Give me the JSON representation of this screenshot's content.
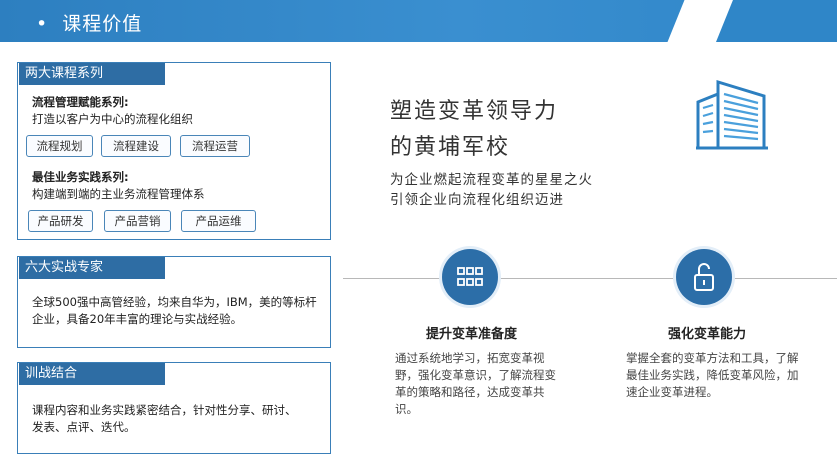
{
  "header": {
    "bullet": "•",
    "title": "课程价值"
  },
  "card1": {
    "tab": "两大课程系列",
    "series1": {
      "title": "流程管理赋能系列:",
      "desc": "打造以客户为中心的流程化组织",
      "tags": [
        "流程规划",
        "流程建设",
        "流程运营"
      ]
    },
    "series2": {
      "title": "最佳业务实践系列:",
      "desc": "构建端到端的主业务流程管理体系",
      "tags": [
        "产品研发",
        "产品营销",
        "产品运维"
      ]
    }
  },
  "card2": {
    "tab": "六大实战专家",
    "text": "全球500强中高管经验，均来自华为，IBM，美的等标杆企业，具备20年丰富的理论与实战经验。"
  },
  "card3": {
    "tab": "训战结合",
    "text": "课程内容和业务实践紧密结合，针对性分享、研讨、发表、点评、迭代。"
  },
  "headline": {
    "line1": "塑造变革领导力",
    "line2": "的黄埔军校",
    "sub1": "为企业燃起流程变革的星星之火",
    "sub2": "引领企业向流程化组织迈进"
  },
  "features": [
    {
      "icon": "grid-icon",
      "title": "提升变革准备度",
      "text": "通过系统地学习，拓宽变革视野，强化变革意识，了解流程变革的策略和路径，达成变革共识。"
    },
    {
      "icon": "unlock-icon",
      "title": "强化变革能力",
      "text": "掌握全套的变革方法和工具，了解最佳业务实践，降低变革风险，加速企业变革进程。"
    }
  ],
  "colors": {
    "header_blue": "#2f86c8",
    "tab_blue": "#2e6da4",
    "border_blue": "#3a7fb8",
    "icon_blue": "#2c6ea8"
  }
}
